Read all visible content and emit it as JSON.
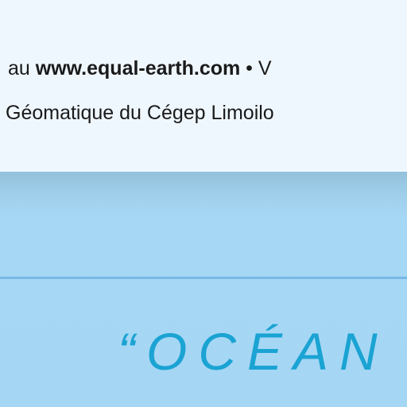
{
  "credits": {
    "line1_prefix": "au ",
    "line1_url": "www.equal-earth.com",
    "line1_sep": " • ",
    "line1_suffix": "V",
    "line2": "Géomatique du Cégep Limoilo"
  },
  "map": {
    "ocean_label": "“OCÉAN",
    "colors": {
      "ocean": "#a5d6f4",
      "label": "#1aa3d3",
      "graticule": "#78b8e8",
      "header": "#eff7fe"
    }
  }
}
